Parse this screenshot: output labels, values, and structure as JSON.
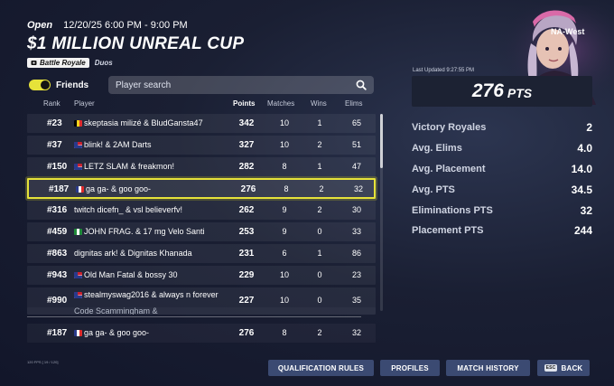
{
  "header": {
    "status": "Open",
    "time_range": "12/20/25 6:00 PM - 9:00 PM",
    "title": "$1 MILLION UNREAL CUP",
    "mode_tag": "Battle Royale",
    "team_type": "Duos"
  },
  "friends": {
    "label": "Friends",
    "enabled": true
  },
  "search": {
    "placeholder": "Player search",
    "value": ""
  },
  "table": {
    "headers": {
      "rank": "Rank",
      "player": "Player",
      "points": "Points",
      "matches": "Matches",
      "wins": "Wins",
      "elims": "Elims"
    },
    "rows": [
      {
        "rank": "#23",
        "player": "skeptasia milizé & BludGansta47",
        "points": "342",
        "matches": "10",
        "wins": "1",
        "elims": "65"
      },
      {
        "rank": "#37",
        "player": "blink! & 2AM Darts",
        "points": "327",
        "matches": "10",
        "wins": "2",
        "elims": "51"
      },
      {
        "rank": "#150",
        "player": "LETZ SLAM & freakmon!",
        "points": "282",
        "matches": "8",
        "wins": "1",
        "elims": "47"
      },
      {
        "rank": "#187",
        "player": "ga ga- & goo goo-",
        "points": "276",
        "matches": "8",
        "wins": "2",
        "elims": "32"
      },
      {
        "rank": "#316",
        "player": "twitch dicefn_ & vsl believerfv!",
        "points": "262",
        "matches": "9",
        "wins": "2",
        "elims": "30"
      },
      {
        "rank": "#459",
        "player": "JOHN FRAG. & 17 mg Velo Santi",
        "points": "253",
        "matches": "9",
        "wins": "0",
        "elims": "33"
      },
      {
        "rank": "#863",
        "player": "dignitas ark! & Dignitas Khanada",
        "points": "231",
        "matches": "6",
        "wins": "1",
        "elims": "86"
      },
      {
        "rank": "#943",
        "player": "Old Man Fatal & bossy 30",
        "points": "229",
        "matches": "10",
        "wins": "0",
        "elims": "23"
      },
      {
        "rank": "#990",
        "player": "stealmyswag2016 & always n forever",
        "points": "227",
        "matches": "10",
        "wins": "0",
        "elims": "35"
      },
      {
        "rank": "",
        "player": "Code Scammingham &",
        "points": "",
        "matches": "",
        "wins": "",
        "elims": ""
      }
    ],
    "pinned": {
      "rank": "#187",
      "player": "ga ga- & goo goo-",
      "points": "276",
      "matches": "8",
      "wins": "2",
      "elims": "32"
    }
  },
  "summary": {
    "region": "NA-West",
    "last_updated": "Last Updated 9:27:55 PM",
    "points": "276",
    "points_unit": "PTS",
    "stats": [
      {
        "label": "Victory Royales",
        "value": "2"
      },
      {
        "label": "Avg. Elims",
        "value": "4.0"
      },
      {
        "label": "Avg. Placement",
        "value": "14.0"
      },
      {
        "label": "Avg. PTS",
        "value": "34.5"
      },
      {
        "label": "Eliminations PTS",
        "value": "32"
      },
      {
        "label": "Placement PTS",
        "value": "244"
      }
    ]
  },
  "footer": {
    "fps": "120 FPS [ 19 / 120]",
    "buttons": {
      "qualification": "QUALIFICATION RULES",
      "profiles": "PROFILES",
      "history": "MATCH HISTORY",
      "back": "BACK",
      "back_key": "ESC"
    }
  },
  "colors": {
    "accent": "#e6e23a",
    "button": "#3b4a72",
    "background": "#12162a"
  },
  "icons": [
    "ticket-icon",
    "search-icon",
    "flag-icon",
    "esc-key-icon"
  ]
}
